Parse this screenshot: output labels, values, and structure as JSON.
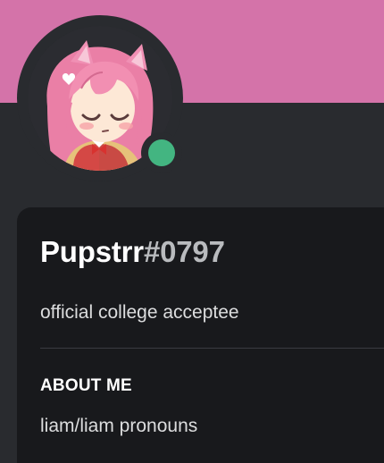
{
  "colors": {
    "banner": "#d473a9",
    "background": "#292b2f",
    "card": "#18191c",
    "status_online": "#43b581",
    "discriminator": "#b9bbbe"
  },
  "profile": {
    "username": "Pupstrr",
    "discriminator": "#0797",
    "status": "online",
    "custom_status": "official college acceptee",
    "avatar_icon": "anime-avatar-pink-hair"
  },
  "about": {
    "title": "ABOUT ME",
    "text": "liam/liam pronouns"
  }
}
